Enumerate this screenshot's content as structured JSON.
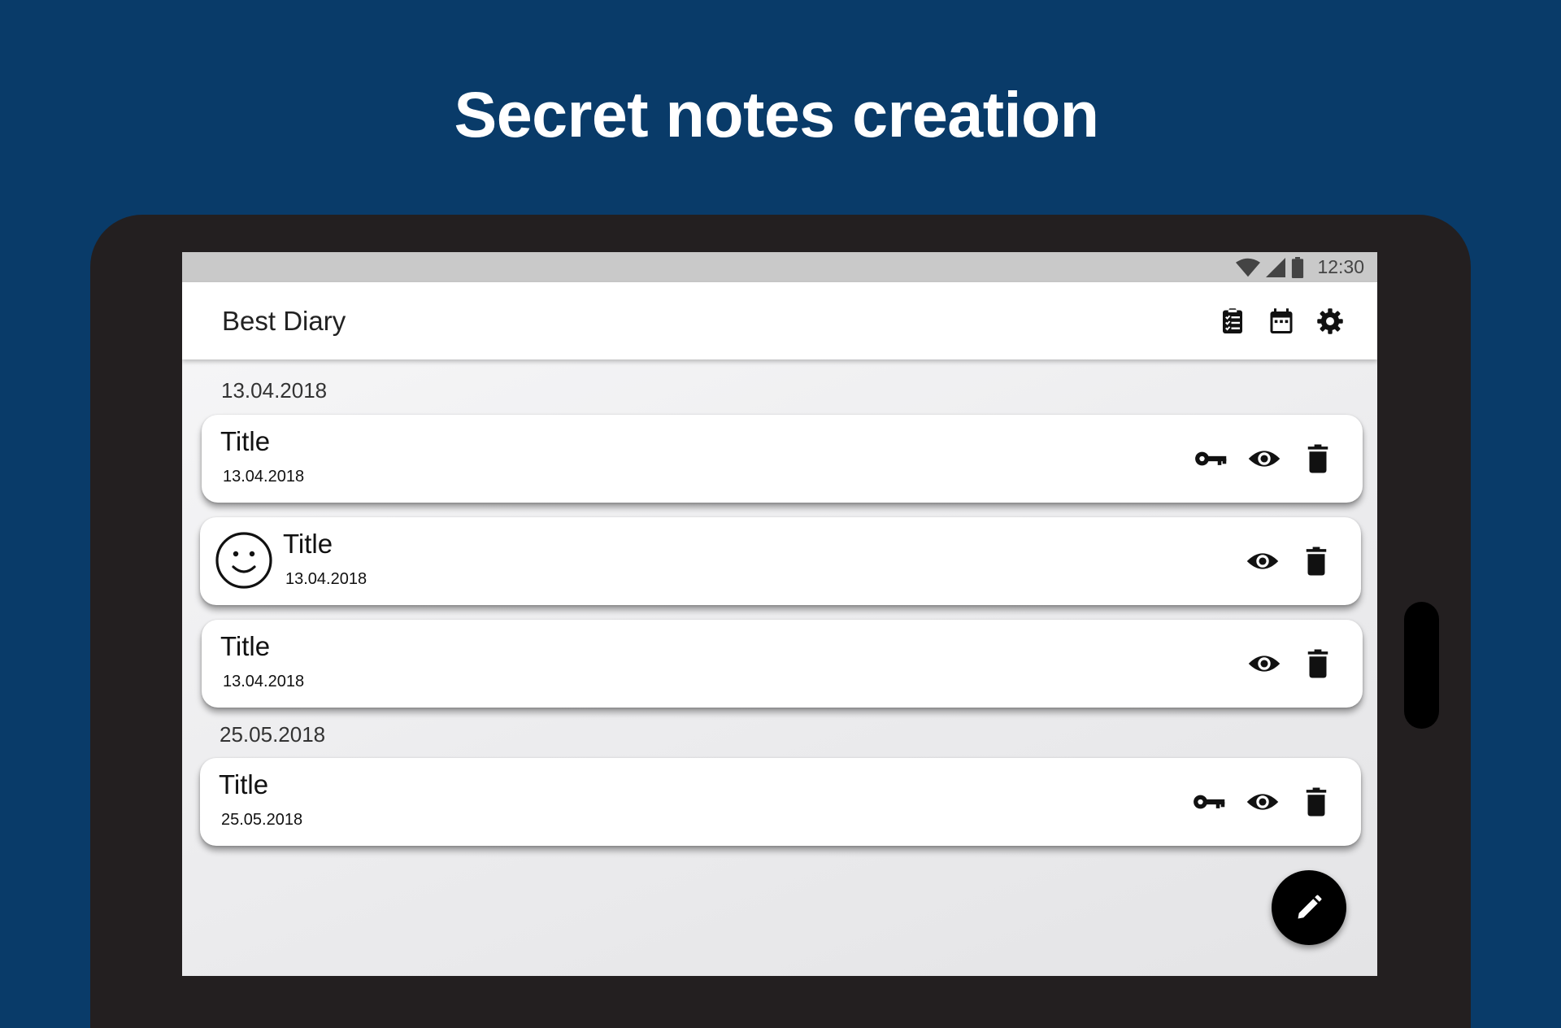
{
  "headline": "Secret notes creation",
  "status_bar": {
    "time": "12:30",
    "icons": [
      "wifi-icon",
      "signal-icon",
      "battery-icon"
    ]
  },
  "app_bar": {
    "title": "Best Diary",
    "actions": [
      "checklist-icon",
      "calendar-icon",
      "gear-icon"
    ]
  },
  "groups": [
    {
      "date": "13.04.2018",
      "notes": [
        {
          "title": "Title",
          "date": "13.04.2018",
          "locked": true,
          "mood": null
        },
        {
          "title": "Title",
          "date": "13.04.2018",
          "locked": false,
          "mood": "smile-icon"
        },
        {
          "title": "Title",
          "date": "13.04.2018",
          "locked": false,
          "mood": null
        }
      ]
    },
    {
      "date": "25.05.2018",
      "notes": [
        {
          "title": "Title",
          "date": "25.05.2018",
          "locked": true,
          "mood": null
        }
      ]
    }
  ],
  "fab": {
    "icon": "pencil-icon"
  },
  "colors": {
    "background": "#093b69",
    "device": "#231f20",
    "status_bar": "#c9c9c9",
    "accent": "#000000"
  }
}
